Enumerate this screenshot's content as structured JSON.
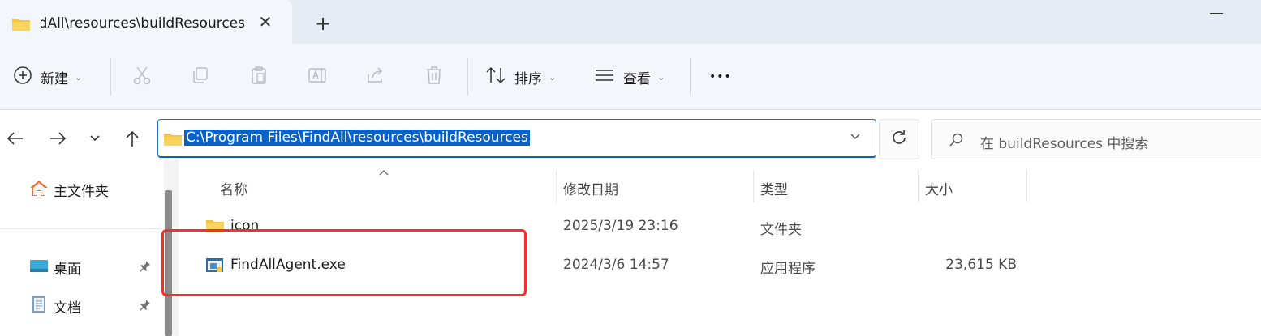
{
  "tab": {
    "title": "FindAll\\resources\\buildResources",
    "close_glyph": "✕",
    "new_glyph": "+"
  },
  "toolbar": {
    "new_label": "新建",
    "sort_label": "排序",
    "view_label": "查看",
    "more_glyph": "•••",
    "chevron": "⌄"
  },
  "address": {
    "path": "C:\\Program Files\\FindAll\\resources\\buildResources",
    "dropdown_glyph": "⌄"
  },
  "search": {
    "placeholder": "在 buildResources 中搜索"
  },
  "sidebar": {
    "items": [
      {
        "label": "主文件夹",
        "icon": "home-icon"
      },
      {
        "label": "桌面",
        "icon": "desktop-icon",
        "pinned": true
      },
      {
        "label": "文档",
        "icon": "document-icon",
        "pinned": true
      }
    ],
    "pin_glyph": "📌"
  },
  "columns": {
    "name": "名称",
    "modified": "修改日期",
    "type": "类型",
    "size": "大小"
  },
  "files": [
    {
      "name": "icon",
      "modified": "2025/3/19 23:16",
      "type": "文件夹",
      "size": "",
      "icon": "folder-icon"
    },
    {
      "name": "FindAllAgent.exe",
      "modified": "2024/3/6 14:57",
      "type": "应用程序",
      "size": "23,615 KB",
      "icon": "exe-icon"
    }
  ],
  "colors": {
    "accent": "#0067c0",
    "highlight_box": "#ff2b2b",
    "folder": "#f5c542"
  }
}
